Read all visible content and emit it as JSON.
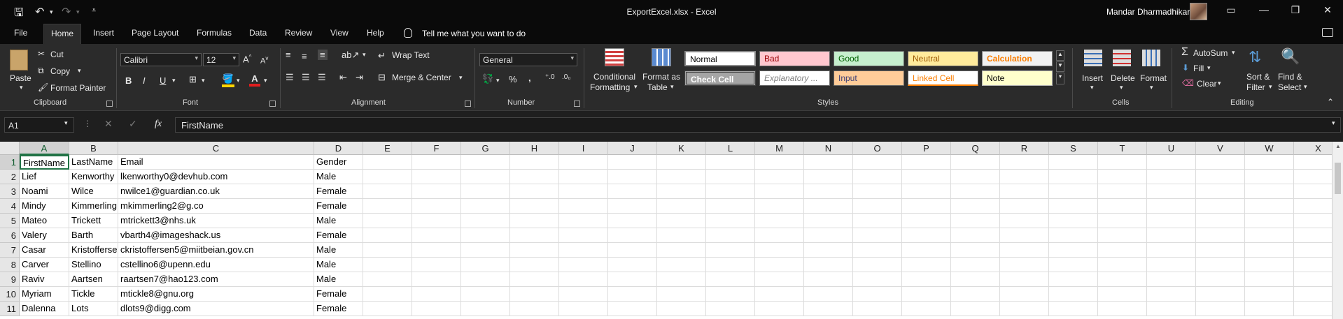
{
  "window": {
    "title": "ExportExcel.xlsx  -  Excel",
    "user": "Mandar Dharmadhikari"
  },
  "tabs": [
    "File",
    "Home",
    "Insert",
    "Page Layout",
    "Formulas",
    "Data",
    "Review",
    "View",
    "Help"
  ],
  "active_tab": "Home",
  "tell_me": "Tell me what you want to do",
  "ribbon": {
    "clipboard": {
      "paste": "Paste",
      "cut": "Cut",
      "copy": "Copy",
      "format_painter": "Format Painter",
      "group": "Clipboard"
    },
    "font": {
      "name": "Calibri",
      "size": "12",
      "bold": "B",
      "italic": "I",
      "underline": "U",
      "group": "Font"
    },
    "alignment": {
      "wrap": "Wrap Text",
      "merge": "Merge & Center",
      "group": "Alignment"
    },
    "number": {
      "format": "General",
      "percent": "%",
      "comma": ",",
      "group": "Number"
    },
    "styles": {
      "conditional": [
        "Conditional",
        "Formatting"
      ],
      "format_table": [
        "Format as",
        "Table"
      ],
      "cells": [
        "Normal",
        "Bad",
        "Good",
        "Neutral",
        "Calculation",
        "Check Cell",
        "Explanatory ...",
        "Input",
        "Linked Cell",
        "Note"
      ],
      "group": "Styles"
    },
    "cells": {
      "insert": "Insert",
      "delete": "Delete",
      "format": "Format",
      "group": "Cells"
    },
    "editing": {
      "autosum": "AutoSum",
      "fill": "Fill",
      "clear": "Clear",
      "sort": [
        "Sort &",
        "Filter"
      ],
      "find": [
        "Find &",
        "Select"
      ],
      "group": "Editing"
    }
  },
  "formula_bar": {
    "name_box": "A1",
    "fx": "fx",
    "content": "FirstName"
  },
  "columns": [
    "A",
    "B",
    "C",
    "D",
    "E",
    "F",
    "G",
    "H",
    "I",
    "J",
    "K",
    "L",
    "M",
    "N",
    "O",
    "P",
    "Q",
    "R",
    "S",
    "T",
    "U",
    "V",
    "W",
    "X"
  ],
  "rows": [
    [
      "FirstName",
      "LastName",
      "Email",
      "Gender"
    ],
    [
      "Lief",
      "Kenworthy",
      "lkenworthy0@devhub.com",
      "Male"
    ],
    [
      "Noami",
      "Wilce",
      "nwilce1@guardian.co.uk",
      "Female"
    ],
    [
      "Mindy",
      "Kimmerling",
      "mkimmerling2@g.co",
      "Female"
    ],
    [
      "Mateo",
      "Trickett",
      "mtrickett3@nhs.uk",
      "Male"
    ],
    [
      "Valery",
      "Barth",
      "vbarth4@imageshack.us",
      "Female"
    ],
    [
      "Casar",
      "Kristoffersen",
      "ckristoffersen5@miitbeian.gov.cn",
      "Male"
    ],
    [
      "Carver",
      "Stellino",
      "cstellino6@upenn.edu",
      "Male"
    ],
    [
      "Raviv",
      "Aartsen",
      "raartsen7@hao123.com",
      "Male"
    ],
    [
      "Myriam",
      "Tickle",
      "mtickle8@gnu.org",
      "Female"
    ],
    [
      "Dalenna",
      "Lots",
      "dlots9@digg.com",
      "Female"
    ]
  ],
  "row_numbers": [
    "1",
    "2",
    "3",
    "4",
    "5",
    "6",
    "7",
    "8",
    "9",
    "10",
    "11"
  ]
}
